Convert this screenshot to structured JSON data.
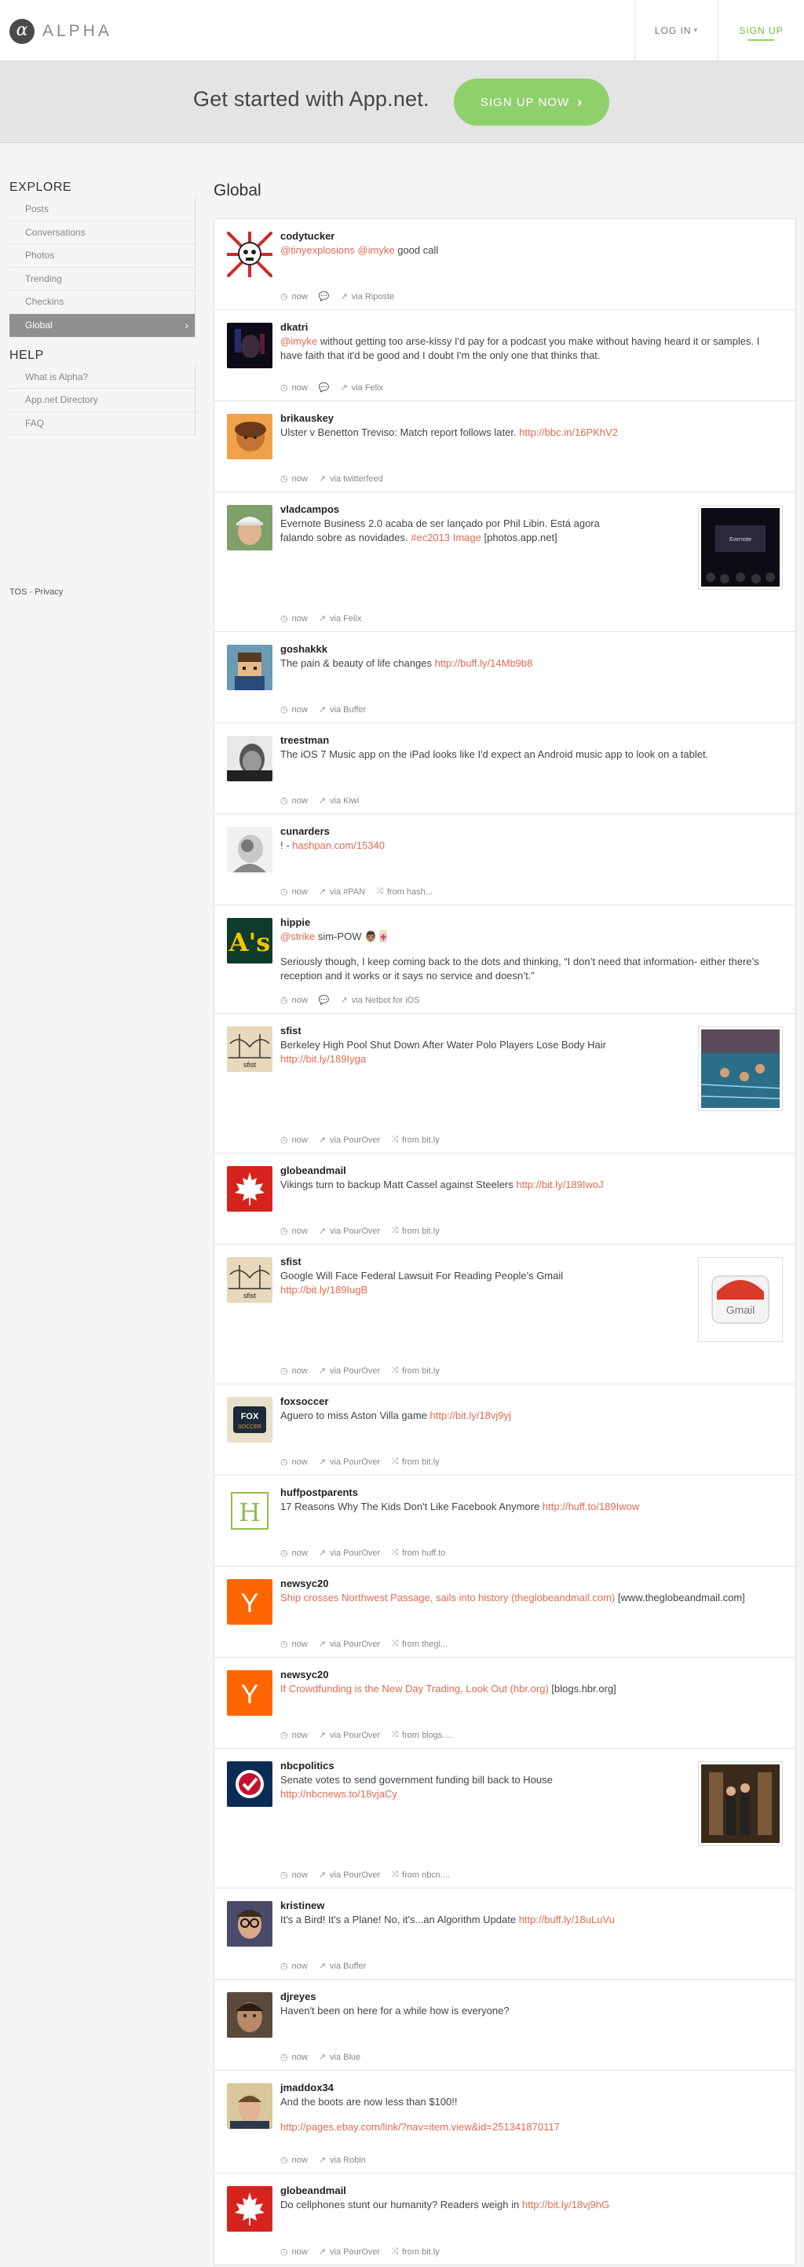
{
  "header": {
    "logo_glyph": "α",
    "logo_text": "ALPHA",
    "login_label": "LOG IN",
    "signup_label": "SIGN UP"
  },
  "hero": {
    "text": "Get started with App.net.",
    "button_label": "SIGN UP NOW"
  },
  "sidebar": {
    "explore_title": "EXPLORE",
    "explore_items": [
      "Posts",
      "Conversations",
      "Photos",
      "Trending",
      "Checkins",
      "Global"
    ],
    "help_title": "HELP",
    "help_items": [
      "What is Alpha?",
      "App.net Directory",
      "FAQ"
    ],
    "tos": "TOS",
    "privacy": "Privacy",
    "separator": " · "
  },
  "main": {
    "title": "Global"
  },
  "posts": [
    {
      "user": "codytucker",
      "segs": [
        {
          "t": "@tinyexplosions @imyke",
          "hl": true
        },
        {
          "t": " good call",
          "hl": false
        }
      ],
      "time": "now",
      "reply": true,
      "via": "via Riposte",
      "from": ""
    },
    {
      "user": "dkatri",
      "segs": [
        {
          "t": "@imyke",
          "hl": true
        },
        {
          "t": " without getting too arse-kissy I'd pay for a podcast you make without having heard it or samples. I have faith that it'd be good and I doubt I'm the only one that thinks that.",
          "hl": false
        }
      ],
      "time": "now",
      "reply": true,
      "via": "via Felix",
      "from": ""
    },
    {
      "user": "brikauskey",
      "segs": [
        {
          "t": "Ulster v Benetton Treviso: Match report follows later. ",
          "hl": false
        },
        {
          "t": "http://bbc.in/16PKhV2",
          "hl": true
        }
      ],
      "time": "now",
      "reply": false,
      "via": "via twitterfeed",
      "from": ""
    },
    {
      "user": "vladcampos",
      "segs": [
        {
          "t": "Evernote Business 2.0 acaba de ser lançado por Phil Libin. Está agora falando sobre as novidades. ",
          "hl": false
        },
        {
          "t": "#ec2013 Image",
          "hl": true
        },
        {
          "t": " [photos.app.net]",
          "hl": false
        }
      ],
      "time": "now",
      "reply": false,
      "via": "via Felix",
      "from": ""
    },
    {
      "user": "goshakkk",
      "segs": [
        {
          "t": "The pain & beauty of life changes ",
          "hl": false
        },
        {
          "t": "http://buff.ly/14Mb9b8",
          "hl": true
        }
      ],
      "time": "now",
      "reply": false,
      "via": "via Buffer",
      "from": ""
    },
    {
      "user": "treestman",
      "segs": [
        {
          "t": "The iOS 7 Music app on the iPad looks like I'd expect an Android music app to look on a tablet.",
          "hl": false
        }
      ],
      "time": "now",
      "reply": false,
      "via": "via Kiwi",
      "from": ""
    },
    {
      "user": "cunarders",
      "segs": [
        {
          "t": "! - ",
          "hl": false
        },
        {
          "t": "hashpan.com/15340",
          "hl": true
        }
      ],
      "time": "now",
      "reply": false,
      "via": "via #PAN",
      "from": "from hash..."
    },
    {
      "user": "hippie",
      "segs": [
        {
          "t": "@strike",
          "hl": true
        },
        {
          "t": " sim-POW 👨🏽🀄",
          "hl": false
        }
      ],
      "segs2": [
        {
          "t": "Seriously though, I keep coming back to the dots and thinking, “I don’t need that information- either there’s reception and it works or it says no service and doesn’t.”",
          "hl": false
        }
      ],
      "time": "now",
      "reply": true,
      "via": "via Netbot for iOS",
      "from": ""
    },
    {
      "user": "sfist",
      "segs": [
        {
          "t": "Berkeley High Pool Shut Down After Water Polo Players Lose Body Hair ",
          "hl": false
        },
        {
          "t": "http://bit.ly/189Iyga",
          "hl": true
        }
      ],
      "time": "now",
      "reply": false,
      "via": "via PourOver",
      "from": "from bit.ly"
    },
    {
      "user": "globeandmail",
      "segs": [
        {
          "t": "Vikings turn to backup Matt Cassel against Steelers ",
          "hl": false
        },
        {
          "t": "http://bit.ly/189IwoJ",
          "hl": true
        }
      ],
      "time": "now",
      "reply": false,
      "via": "via PourOver",
      "from": "from bit.ly"
    },
    {
      "user": "sfist",
      "segs": [
        {
          "t": "Google Will Face Federal Lawsuit For Reading People's Gmail ",
          "hl": false
        },
        {
          "t": "http://bit.ly/189IugB",
          "hl": true
        }
      ],
      "time": "now",
      "reply": false,
      "via": "via PourOver",
      "from": "from bit.ly"
    },
    {
      "user": "foxsoccer",
      "segs": [
        {
          "t": "Aguero to miss Aston Villa game ",
          "hl": false
        },
        {
          "t": "http://bit.ly/18vj9yj",
          "hl": true
        }
      ],
      "time": "now",
      "reply": false,
      "via": "via PourOver",
      "from": "from bit.ly"
    },
    {
      "user": "huffpostparents",
      "segs": [
        {
          "t": "17 Reasons Why The Kids Don't Like Facebook Anymore ",
          "hl": false
        },
        {
          "t": "http://huff.to/189Iwow",
          "hl": true
        }
      ],
      "time": "now",
      "reply": false,
      "via": "via PourOver",
      "from": "from huff.to"
    },
    {
      "user": "newsyc20",
      "segs": [
        {
          "t": "Ship crosses Northwest Passage, sails into history (theglobeandmail.com)",
          "hl": true
        },
        {
          "t": " [www.theglobeandmail.com]",
          "hl": false
        }
      ],
      "time": "now",
      "reply": false,
      "via": "via PourOver",
      "from": "from thegl..."
    },
    {
      "user": "newsyc20",
      "segs": [
        {
          "t": "If Crowdfunding is the New Day Trading, Look Out (hbr.org)",
          "hl": true
        },
        {
          "t": " [blogs.hbr.org]",
          "hl": false
        }
      ],
      "time": "now",
      "reply": false,
      "via": "via PourOver",
      "from": "from blogs...."
    },
    {
      "user": "nbcpolitics",
      "segs": [
        {
          "t": "Senate votes to send government funding bill back to House ",
          "hl": false
        },
        {
          "t": "http://nbcnews.to/18vjaCy",
          "hl": true
        }
      ],
      "time": "now",
      "reply": false,
      "via": "via PourOver",
      "from": "from nbcn...."
    },
    {
      "user": "kristinew",
      "segs": [
        {
          "t": "It's a Bird! It's a Plane! No, it's...an Algorithm Update ",
          "hl": false
        },
        {
          "t": "http://buff.ly/18uLuVu",
          "hl": true
        }
      ],
      "time": "now",
      "reply": false,
      "via": "via Buffer",
      "from": ""
    },
    {
      "user": "djreyes",
      "segs": [
        {
          "t": "Haven't been on here for a while how is everyone?",
          "hl": false
        }
      ],
      "time": "now",
      "reply": false,
      "via": "via Blue",
      "from": ""
    },
    {
      "user": "jmaddox34",
      "segs": [
        {
          "t": "And the boots are now less than $100!!",
          "hl": false
        }
      ],
      "segs2": [
        {
          "t": "http://pages.ebay.com/link/?nav=item.view&id=251341870117",
          "hl": true
        }
      ],
      "time": "now",
      "reply": false,
      "via": "via Robin",
      "from": ""
    },
    {
      "user": "globeandmail",
      "segs": [
        {
          "t": "Do cellphones stunt our humanity? Readers weigh in ",
          "hl": false
        },
        {
          "t": "http://bit.ly/18vj9hG",
          "hl": true
        }
      ],
      "time": "now",
      "reply": false,
      "via": "via PourOver",
      "from": "from bit.ly"
    }
  ],
  "colors": {
    "accent_link": "#e06b51",
    "signup_green": "#8fd06c",
    "nav_active": "#8f8f8f"
  }
}
